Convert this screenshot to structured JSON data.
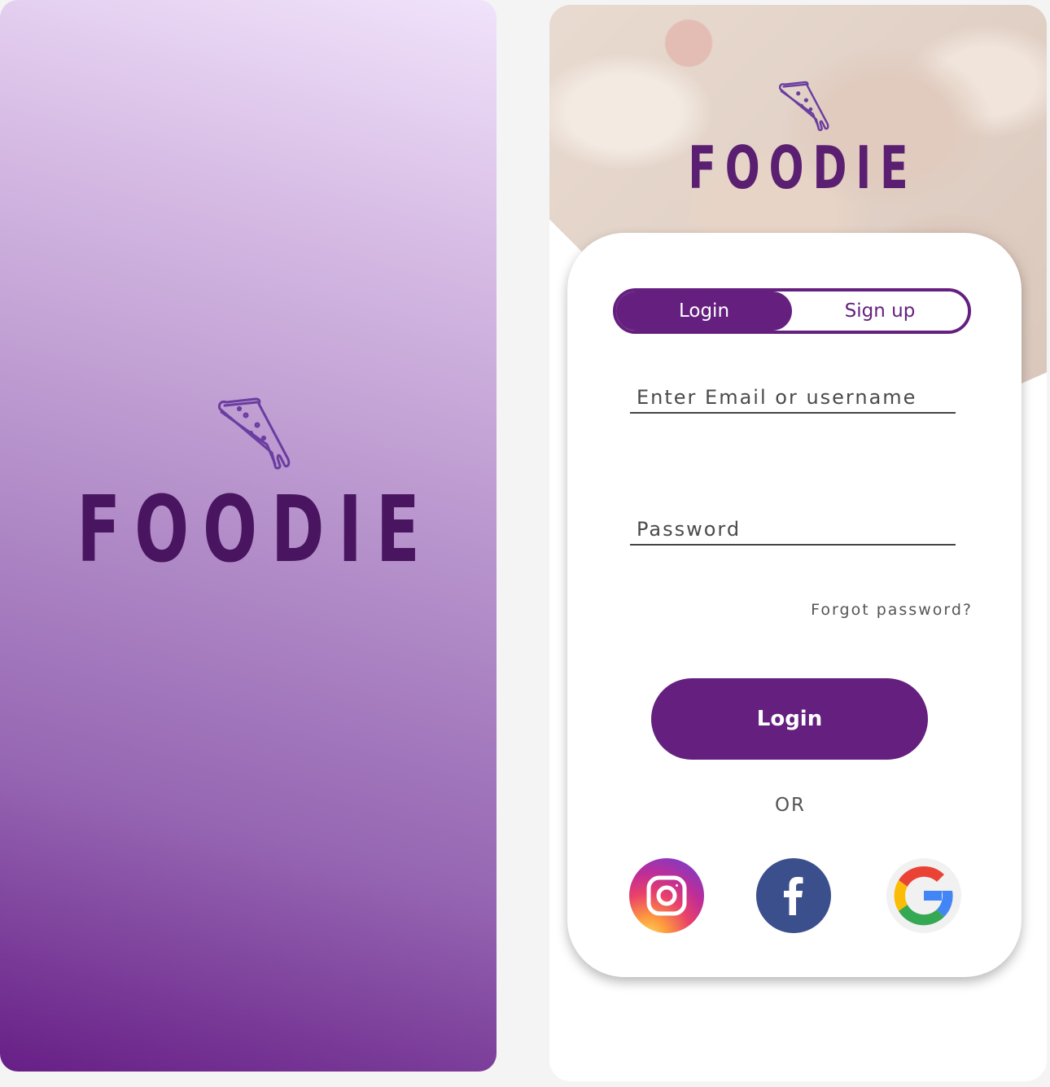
{
  "splash": {
    "brand": "FOODIE",
    "logo_icon": "pizza-slice-icon",
    "gradient_top": "#f1e3fb",
    "gradient_bottom": "#671f86"
  },
  "login_screen": {
    "brand": "FOODIE",
    "logo_icon": "pizza-slice-icon",
    "tabs": [
      {
        "label": "Login",
        "active": true
      },
      {
        "label": "Sign up",
        "active": false
      }
    ],
    "email_field": {
      "placeholder": "Enter Email or username",
      "value": ""
    },
    "password_field": {
      "placeholder": "Password",
      "value": ""
    },
    "forgot_password": "Forgot password?",
    "login_button": "Login",
    "or_divider": "OR",
    "social": [
      {
        "name": "instagram",
        "icon": "instagram-icon"
      },
      {
        "name": "facebook",
        "icon": "facebook-icon",
        "glyph": "f"
      },
      {
        "name": "google",
        "icon": "google-icon"
      }
    ]
  },
  "colors": {
    "accent": "#65207f",
    "brand_dark": "#4a1560",
    "page_background": "#f4f4f4"
  }
}
